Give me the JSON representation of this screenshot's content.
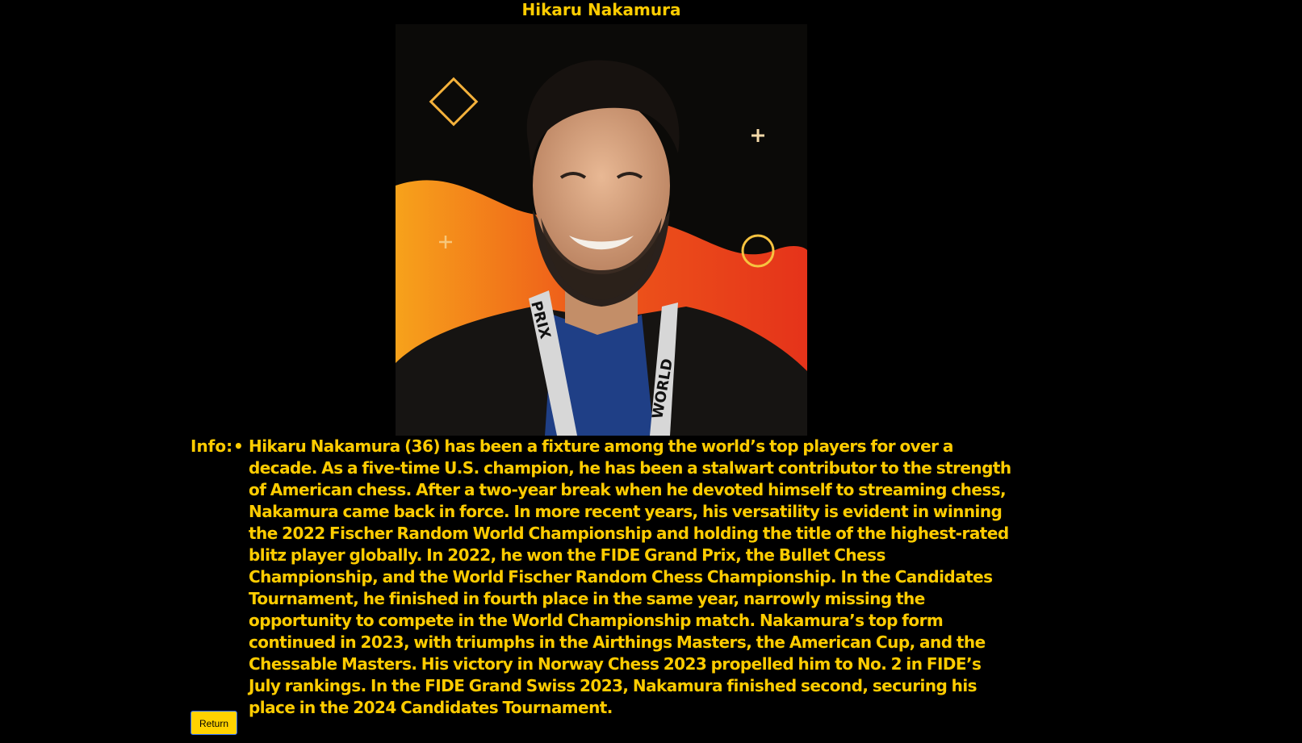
{
  "page": {
    "title": "Hikaru Nakamura"
  },
  "portrait": {
    "subject": "Hikaru Nakamura portrait photo",
    "lanyard_text_left": "PRIX",
    "lanyard_text_right": "WORLD"
  },
  "info": {
    "label": "Info:",
    "items": [
      "Hikaru Nakamura (36) has been a fixture among the world’s top players for over a decade. As a five-time U.S. champion, he has been a stalwart contributor to the strength of American chess. After a two-year break when he devoted himself to streaming chess, Nakamura came back in force. In more recent years, his versatility is evident in winning the 2022 Fischer Random World Championship and holding the title of the highest-rated blitz player globally. In 2022, he won the FIDE Grand Prix, the Bullet Chess Championship, and the World Fischer Random Chess Championship. In the Candidates Tournament, he finished in fourth place in the same year, narrowly missing the opportunity to compete in the World Championship match. Nakamura’s top form continued in 2023, with triumphs in the Airthings Masters, the American Cup, and the Chessable Masters. His victory in Norway Chess 2023 propelled him to No. 2 in FIDE’s July rankings. In the FIDE Grand Swiss 2023, Nakamura finished second, securing his place in the 2024 Candidates Tournament."
    ]
  },
  "actions": {
    "return_label": "Return"
  },
  "colors": {
    "background": "#000000",
    "text": "#FFCC00",
    "button": "#FFD200"
  }
}
